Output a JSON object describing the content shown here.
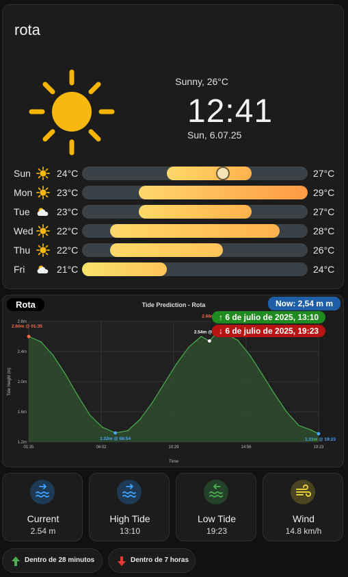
{
  "weather": {
    "city": "rota",
    "condition": "Sunny, 26°C",
    "time": "12:41",
    "date": "Sun, 6.07.25",
    "forecast": [
      {
        "day": "Sun",
        "icon": "sun-icon",
        "low": "24°C",
        "high": "27°C",
        "low_val": 24,
        "high_val": 27,
        "current_val": 26
      },
      {
        "day": "Mon",
        "icon": "sun-icon",
        "low": "23°C",
        "high": "29°C",
        "low_val": 23,
        "high_val": 29
      },
      {
        "day": "Tue",
        "icon": "partly-cloudy-icon",
        "low": "23°C",
        "high": "27°C",
        "low_val": 23,
        "high_val": 27
      },
      {
        "day": "Wed",
        "icon": "sun-icon",
        "low": "22°C",
        "high": "28°C",
        "low_val": 22,
        "high_val": 28
      },
      {
        "day": "Thu",
        "icon": "sun-icon",
        "low": "22°C",
        "high": "26°C",
        "low_val": 22,
        "high_val": 26
      },
      {
        "day": "Fri",
        "icon": "partly-cloudy-icon",
        "low": "21°C",
        "high": "24°C",
        "low_val": 21,
        "high_val": 24
      }
    ],
    "range_min": 21,
    "range_max": 29
  },
  "tide": {
    "location_tag": "Rota",
    "now_label": "Now: 2,54 m m",
    "high_label": "↑ 6 de julio de 2025, 13:10",
    "low_label": "↓ 6 de julio de 2025, 19:23",
    "high_color": "#1f8a1f",
    "low_color": "#b81414",
    "now_color": "#1e5fa8"
  },
  "chart_data": {
    "type": "area",
    "title": "Tide Prediction - Rota",
    "xlabel": "Time",
    "ylabel": "Tide Height (m)",
    "x": [
      "01:35",
      "02:20",
      "03:05",
      "03:50",
      "04:35",
      "05:20",
      "06:05",
      "06:54",
      "07:40",
      "08:25",
      "09:10",
      "09:55",
      "10:40",
      "11:25",
      "12:10",
      "12:41",
      "13:10",
      "13:40",
      "14:25",
      "15:10",
      "15:55",
      "16:40",
      "17:25",
      "18:10",
      "18:55",
      "19:23"
    ],
    "values": [
      2.6,
      2.53,
      2.35,
      2.1,
      1.82,
      1.56,
      1.4,
      1.32,
      1.35,
      1.5,
      1.72,
      1.98,
      2.24,
      2.46,
      2.6,
      2.54,
      2.66,
      2.64,
      2.55,
      2.35,
      2.1,
      1.84,
      1.6,
      1.42,
      1.36,
      1.31
    ],
    "x_ticks": [
      "01:35",
      "06:02",
      "10:29",
      "14:56",
      "19:23"
    ],
    "y_ticks": [
      "1.2m",
      "1.6m",
      "2.0m",
      "2.4m",
      "2.8m"
    ],
    "ylim": [
      1.2,
      2.8
    ],
    "grid": true,
    "annotations": [
      {
        "text": "2.60m @ 01:35",
        "x": "01:35",
        "y": 2.6,
        "color": "#ff6b4a"
      },
      {
        "text": "1.32m @ 06:54",
        "x": "06:54",
        "y": 1.32,
        "color": "#4aa8ff"
      },
      {
        "text": "2.66m @ 13:10",
        "x": "13:10",
        "y": 2.66,
        "color": "#ff6b4a"
      },
      {
        "text": "2.54m @ 12:41",
        "x": "12:41",
        "y": 2.54,
        "color": "#ffffff"
      },
      {
        "text": "1.31m @ 19:23",
        "x": "19:23",
        "y": 1.31,
        "color": "#4aa8ff"
      }
    ],
    "line_color": "#4caf50",
    "fill_color": "#2c4a2c"
  },
  "tiles": [
    {
      "label": "Current",
      "value": "2.54 m",
      "icon": "waves-arrow-right-icon",
      "color": "#3fa4ff",
      "bg": "#1e3a55"
    },
    {
      "label": "High Tide",
      "value": "13:10",
      "icon": "waves-arrow-right-icon",
      "color": "#3fa4ff",
      "bg": "#1e3a55"
    },
    {
      "label": "Low Tide",
      "value": "19:23",
      "icon": "waves-arrow-left-icon",
      "color": "#4caf50",
      "bg": "#24412a"
    },
    {
      "label": "Wind",
      "value": "14.8 km/h",
      "icon": "wind-icon",
      "color": "#e6cf3c",
      "bg": "#4a4420"
    }
  ],
  "chips": [
    {
      "label": "Dentro de 28 minutos",
      "icon": "arrow-up-icon",
      "color": "#4caf50"
    },
    {
      "label": "Dentro de 7 horas",
      "icon": "arrow-down-icon",
      "color": "#e53935"
    }
  ]
}
